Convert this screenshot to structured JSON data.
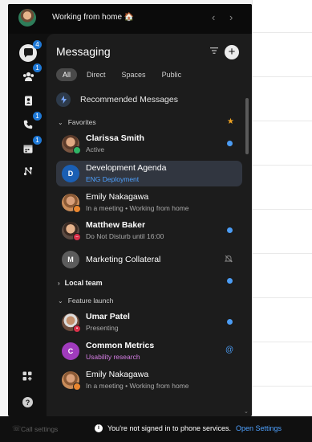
{
  "header": {
    "status_text": "Working from home",
    "status_emoji": "🏠",
    "back": "‹",
    "forward": "›"
  },
  "rail": {
    "items": [
      {
        "name": "messaging",
        "badge": "4"
      },
      {
        "name": "teams",
        "badge": "1"
      },
      {
        "name": "contacts",
        "badge": ""
      },
      {
        "name": "calling",
        "badge": "1"
      },
      {
        "name": "meetings",
        "badge": "1"
      },
      {
        "name": "workflows",
        "badge": ""
      }
    ],
    "help_label": "?"
  },
  "panel": {
    "title": "Messaging",
    "tabs": [
      "All",
      "Direct",
      "Spaces",
      "Public"
    ],
    "recommended_label": "Recommended Messages",
    "sections": {
      "favorites": "Favorites",
      "local_team": "Local team",
      "feature_launch": "Feature launch"
    },
    "rows": [
      {
        "name": "Clarissa Smith",
        "sub": "Active",
        "initial": ""
      },
      {
        "name": "Development Agenda",
        "sub": "ENG Deployment",
        "initial": "D"
      },
      {
        "name": "Emily Nakagawa",
        "sub": "In a meeting  •  Working from home",
        "initial": ""
      },
      {
        "name": "Matthew Baker",
        "sub": "Do Not Disturb until 16:00",
        "initial": ""
      },
      {
        "name": "Marketing Collateral",
        "sub": "",
        "initial": "M"
      },
      {
        "name": "Umar Patel",
        "sub": "Presenting",
        "initial": ""
      },
      {
        "name": "Common Metrics",
        "sub": "Usability research",
        "initial": "C"
      },
      {
        "name": "Emily Nakagawa",
        "sub": "In a meeting  •  Working from home",
        "initial": ""
      }
    ],
    "at_symbol": "@"
  },
  "footer": {
    "call_settings": "Call settings",
    "notice": "You're not signed in to phone services.",
    "open_settings": "Open Settings"
  },
  "colors": {
    "accent": "#4b9cf4",
    "star": "#f0a322",
    "selected_row": "#313640"
  }
}
